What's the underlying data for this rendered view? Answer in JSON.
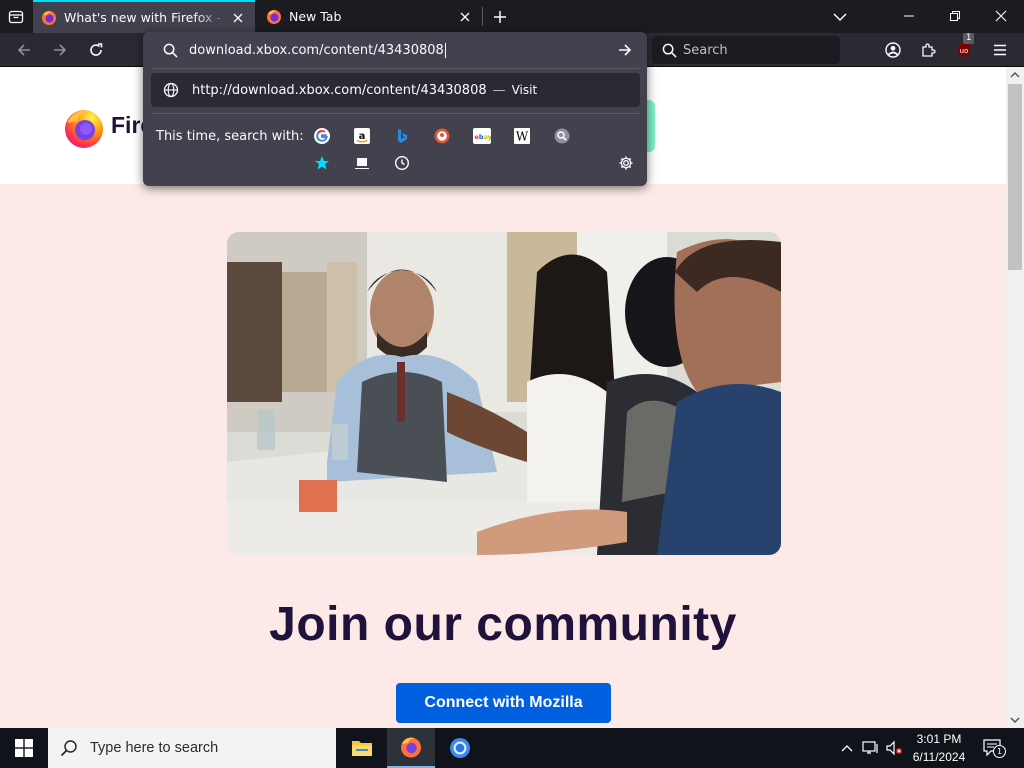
{
  "browser": {
    "tabs": [
      {
        "title": "What's new with Firefox - More",
        "active": true
      },
      {
        "title": "New Tab",
        "active": false
      }
    ],
    "url_input": "download.xbox.com/content/43430808",
    "search_placeholder": "Search",
    "extension_badge": "1"
  },
  "url_dropdown": {
    "result_url": "http://download.xbox.com/content/43430808",
    "result_dash": "—",
    "result_action": "Visit",
    "search_with_label": "This time, search with:",
    "engines": [
      "google-icon",
      "amazon-icon",
      "bing-icon",
      "duckduckgo-icon",
      "ebay-icon",
      "wikipedia-icon",
      "search-engine-icon",
      "bookmarks-icon",
      "tabs-icon",
      "history-icon"
    ]
  },
  "page": {
    "logo_text": "Firef",
    "heading": "Join our community",
    "cta_label": "Connect with Mozilla"
  },
  "taskbar": {
    "search_placeholder": "Type here to search",
    "time": "3:01 PM",
    "date": "6/11/2024",
    "notification_count": "1"
  },
  "colors": {
    "accent": "#0060df",
    "page_bg": "#fdeae8",
    "heading": "#20123a",
    "active_tab_line": "#00ddff"
  }
}
